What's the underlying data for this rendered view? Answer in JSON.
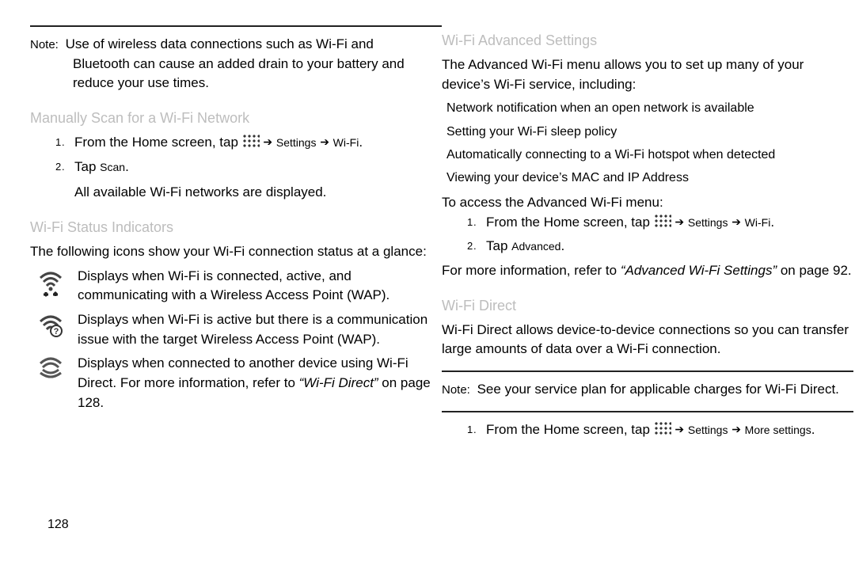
{
  "left": {
    "note_label": "Note:",
    "note_line1": "Use of wireless data connections such as Wi-Fi and",
    "note_line2": "Bluetooth can cause an added drain to your battery and reduce your use times.",
    "sec_manual": "Manually Scan for a Wi-Fi Network",
    "step1_a": "From the Home screen, tap",
    "step1_b": "Settings",
    "step1_c": "Wi-Fi",
    "step2_a": "Tap",
    "step2_b": "Scan",
    "step2_after": "All available Wi-Fi networks are displayed.",
    "sec_status": "Wi-Fi Status Indicators",
    "status_intro": "The following icons show your Wi-Fi connection status at a glance:",
    "ind1": "Displays when Wi-Fi is connected, active, and communicating with a Wireless Access Point (WAP).",
    "ind2": "Displays when Wi-Fi is active but there is a communication issue with the target Wireless Access Point (WAP).",
    "ind3a": "Displays when connected to another device using Wi-Fi Direct. For more information, refer to ",
    "ind3b": "“Wi-Fi Direct”",
    "ind3c": " on page 128."
  },
  "right": {
    "sec_adv": "Wi-Fi Advanced Settings",
    "adv_intro": "The Advanced Wi-Fi menu allows you to set up many of your device’s Wi-Fi service, including:",
    "b1": "Network notification when an open network is available",
    "b2": "Setting your Wi-Fi sleep policy",
    "b3": "Automatically connecting to a Wi-Fi hotspot when detected",
    "b4": "Viewing your device’s MAC and IP Address",
    "adv_access": "To access the Advanced Wi-Fi menu:",
    "adv_s1a": "From the Home screen, tap",
    "adv_s1b": "Settings",
    "adv_s1c": "Wi-Fi",
    "adv_s2a": "Tap",
    "adv_s2b": "Advanced",
    "adv_more1": "For more information, refer to ",
    "adv_more2": "“Advanced Wi-Fi Settings”",
    "adv_more3": " on page 92.",
    "sec_direct": "Wi-Fi Direct",
    "direct_p": "Wi-Fi Direct allows device-to-device connections so you can transfer large amounts of data over a Wi-Fi connection.",
    "note_label": "Note:",
    "note_txt": "See your service plan for applicable charges for Wi-Fi Direct.",
    "d_s1a": "From the Home screen, tap",
    "d_s1b": "Settings",
    "d_s1c": "More settings",
    "dot": "."
  },
  "page_number": "128"
}
